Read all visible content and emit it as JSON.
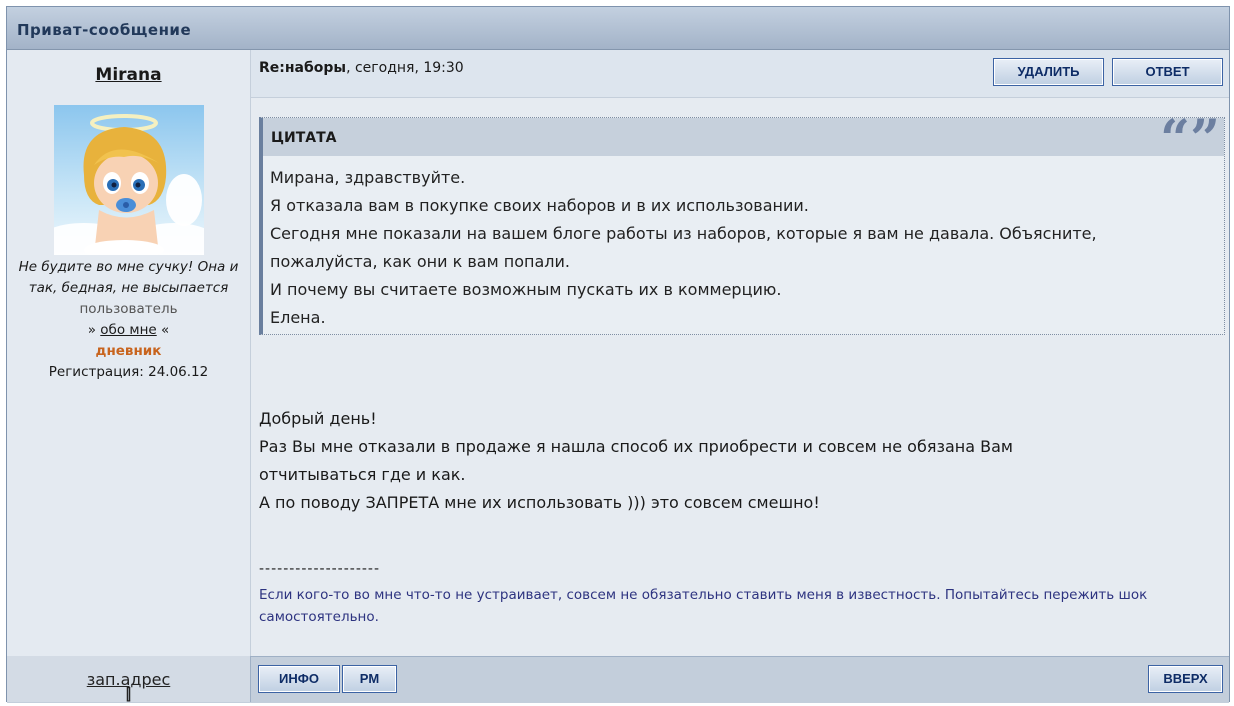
{
  "window": {
    "title": "Приват-сообщение"
  },
  "author": {
    "name": "Mirana",
    "quote_line": "Не будите во мне сучку! Она и так, бедная, не высыпается",
    "role": "пользователь",
    "about_prefix": "»",
    "about_link": "обо мне",
    "about_suffix": "«",
    "diary_link": "дневник",
    "registration": "Регистрация: 24.06.12"
  },
  "message": {
    "subject": "Re:наборы",
    "time": ", сегодня, 19:30",
    "quote_label": "ЦИТАТА",
    "quote_marks": "“”",
    "quote_lines": [
      "Мирана, здравствуйте.",
      "Я отказала вам в покупке своих наборов и в их использовании.",
      "Сегодня мне показали на вашем блоге работы из наборов, которые я вам не давала. Объясните,",
      "пожалуйста, как они к вам попали.",
      "И почему вы считаете возможным пускать их в коммерцию.",
      "Елена."
    ],
    "body_lines": [
      "Добрый день!",
      "Раз Вы мне отказали в продаже я нашла способ их приобрести и совсем не обязана Вам",
      "отчитываться где и как.",
      "А по поводу ЗАПРЕТА мне их использовать ))) это совсем смешно!"
    ],
    "sig_divider": "--------------------",
    "signature": "Если кого-то во мне что-то не устраивает, совсем не обязательно ставить меня в известность. Попытайтесь пережить шок самостоятельно."
  },
  "buttons": {
    "delete": "УДАЛИТЬ",
    "reply": "ОТВЕТ",
    "info": "ИНФО",
    "pm": "PM",
    "top": "ВВЕРХ"
  },
  "footer": {
    "bracket_open": "[",
    "address_link": "зап.адрес",
    "bracket_close": "]"
  }
}
